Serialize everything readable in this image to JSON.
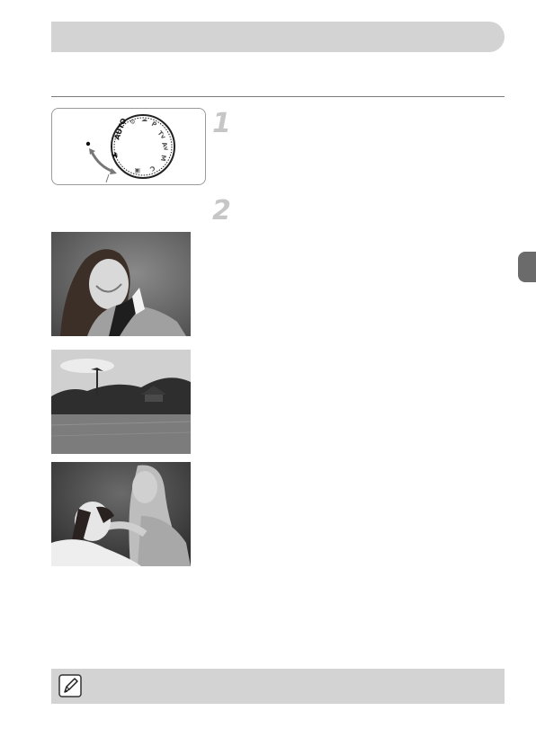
{
  "page": {
    "steps": [
      "1",
      "2"
    ]
  },
  "icons": {
    "mode_dial": "mode-dial-icon",
    "note": "pencil-icon"
  },
  "colors": {
    "title_bar": "#d3d3d3",
    "step_number": "#c6c6c6",
    "side_tab": "#6b6b6b",
    "note_bar": "#d3d3d3"
  },
  "photos": [
    {
      "subject": "portrait-woman"
    },
    {
      "subject": "landscape-lake"
    },
    {
      "subject": "child-with-dog"
    }
  ]
}
